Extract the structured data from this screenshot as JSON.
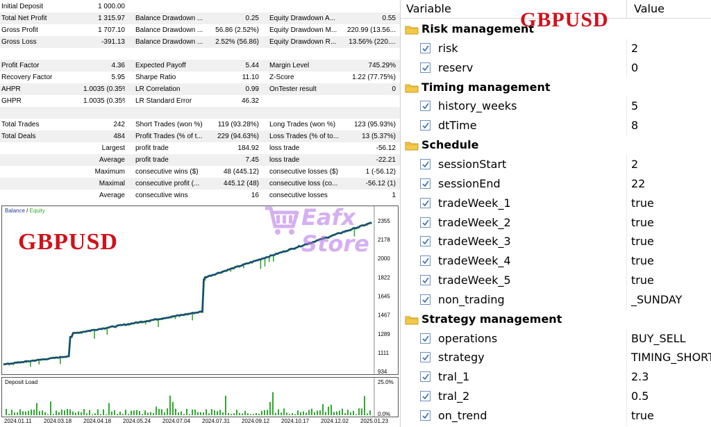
{
  "report": {
    "rows": [
      {
        "l1": "Initial Deposit",
        "v1": "1 000.00",
        "l2": "",
        "v2": "",
        "l3": "",
        "v3": "",
        "shade": false
      },
      {
        "l1": "Total Net Profit",
        "v1": "1 315.97",
        "l2": "Balance Drawdown ...",
        "v2": "0.25",
        "l3": "Equity Drawdown A...",
        "v3": "0.55",
        "shade": true
      },
      {
        "l1": "Gross Profit",
        "v1": "1 707.10",
        "l2": "Balance Drawdown ...",
        "v2": "56.86 (2.52%)",
        "l3": "Equity Drawdown M...",
        "v3": "220.99 (13.56...",
        "shade": false
      },
      {
        "l1": "Gross Loss",
        "v1": "-391.13",
        "l2": "Balance Drawdown ...",
        "v2": "2.52% (56.86)",
        "l3": "Equity Drawdown R...",
        "v3": "13.56% (220....",
        "shade": true
      },
      {
        "l1": "",
        "v1": "",
        "l2": "",
        "v2": "",
        "l3": "",
        "v3": "",
        "shade": false
      },
      {
        "l1": "Profit Factor",
        "v1": "4.36",
        "l2": "Expected Payoff",
        "v2": "5.44",
        "l3": "Margin Level",
        "v3": "745.29%",
        "shade": true
      },
      {
        "l1": "Recovery Factor",
        "v1": "5.95",
        "l2": "Sharpe Ratio",
        "v2": "11.10",
        "l3": "Z-Score",
        "v3": "1.22 (77.75%)",
        "shade": false
      },
      {
        "l1": "AHPR",
        "v1": "1.0035 (0.35%)",
        "l2": "LR Correlation",
        "v2": "0.99",
        "l3": "OnTester result",
        "v3": "0",
        "shade": true
      },
      {
        "l1": "GHPR",
        "v1": "1.0035 (0.35%)",
        "l2": "LR Standard Error",
        "v2": "46.32",
        "l3": "",
        "v3": "",
        "shade": false
      },
      {
        "l1": "",
        "v1": "",
        "l2": "",
        "v2": "",
        "l3": "",
        "v3": "",
        "shade": true
      },
      {
        "l1": "Total Trades",
        "v1": "242",
        "l2": "Short Trades (won %)",
        "v2": "119 (93.28%)",
        "l3": "Long Trades (won %)",
        "v3": "123 (95.93%)",
        "shade": false
      },
      {
        "l1": "Total Deals",
        "v1": "484",
        "l2": "Profit Trades (% of t...",
        "v2": "229 (94.63%)",
        "l3": "Loss Trades (% of to...",
        "v3": "13 (5.37%)",
        "shade": true
      },
      {
        "l1": "Largest",
        "v1": "",
        "l2": "profit trade",
        "v2": "184.92",
        "l3": "loss trade",
        "v3": "-56.12",
        "shade": false,
        "rightLabel": true
      },
      {
        "l1": "Average",
        "v1": "",
        "l2": "profit trade",
        "v2": "7.45",
        "l3": "loss trade",
        "v3": "-22.21",
        "shade": true,
        "rightLabel": true
      },
      {
        "l1": "Maximum",
        "v1": "",
        "l2": "consecutive wins ($)",
        "v2": "48 (445.12)",
        "l3": "consecutive losses ($)",
        "v3": "1 (-56.12)",
        "shade": false,
        "rightLabel": true
      },
      {
        "l1": "Maximal",
        "v1": "",
        "l2": "consecutive profit (...",
        "v2": "445.12 (48)",
        "l3": "consecutive loss (co...",
        "v3": "-56.12 (1)",
        "shade": true,
        "rightLabel": true
      },
      {
        "l1": "Average",
        "v1": "",
        "l2": "consecutive wins",
        "v2": "16",
        "l3": "consecutive losses",
        "v3": "1",
        "shade": false,
        "rightLabel": true
      }
    ]
  },
  "chart_data": [
    {
      "type": "line",
      "title": "",
      "legend": [
        "Balance",
        "Equity"
      ],
      "colors": {
        "balance": "#1f3c8f",
        "equity": "#2fa82f"
      },
      "x": [
        "2024.01.11",
        "2024.03.18",
        "2024.04.18",
        "2024.05.24",
        "2024.07.04",
        "2024.07.31",
        "2024.09.12",
        "2024.10.17",
        "2024.12.02",
        "2025.01.23"
      ],
      "series": [
        {
          "name": "Balance",
          "values": [
            1000,
            1080,
            1290,
            1340,
            1440,
            1500,
            1820,
            1900,
            2040,
            2200,
            2340
          ]
        }
      ],
      "yticks": [
        "2355",
        "2178",
        "2000",
        "1822",
        "1645",
        "1467",
        "1289",
        "1111",
        "934"
      ],
      "ylim": [
        934,
        2400
      ]
    },
    {
      "type": "bar",
      "title": "Deposit Load",
      "yticks": [
        "25.0%",
        "0.0%"
      ],
      "ylim": [
        0,
        25
      ]
    }
  ],
  "watermark": {
    "text": "Eafx Store"
  },
  "overlay_left": "GBPUSD",
  "overlay_right": "GBPUSD",
  "inputs": {
    "col_variable": "Variable",
    "col_value": "Value",
    "rows": [
      {
        "group": true,
        "name": "Risk management"
      },
      {
        "name": "risk",
        "value": "2"
      },
      {
        "name": "reserv",
        "value": "0"
      },
      {
        "group": true,
        "name": "Timing management"
      },
      {
        "name": "history_weeks",
        "value": "5"
      },
      {
        "name": "dtTime",
        "value": "8"
      },
      {
        "group": true,
        "name": "Schedule"
      },
      {
        "name": "sessionStart",
        "value": "2"
      },
      {
        "name": "sessionEnd",
        "value": "22"
      },
      {
        "name": "tradeWeek_1",
        "value": "true"
      },
      {
        "name": "tradeWeek_2",
        "value": "true"
      },
      {
        "name": "tradeWeek_3",
        "value": "true"
      },
      {
        "name": "tradeWeek_4",
        "value": "true"
      },
      {
        "name": "tradeWeek_5",
        "value": "true"
      },
      {
        "name": "non_trading",
        "value": "_SUNDAY"
      },
      {
        "group": true,
        "name": "Strategy management"
      },
      {
        "name": "operations",
        "value": "BUY_SELL"
      },
      {
        "name": "strategy",
        "value": "TIMING_SHORT"
      },
      {
        "name": "tral_1",
        "value": "2.3"
      },
      {
        "name": "tral_2",
        "value": "0.5"
      },
      {
        "name": "on_trend",
        "value": "true"
      }
    ]
  }
}
